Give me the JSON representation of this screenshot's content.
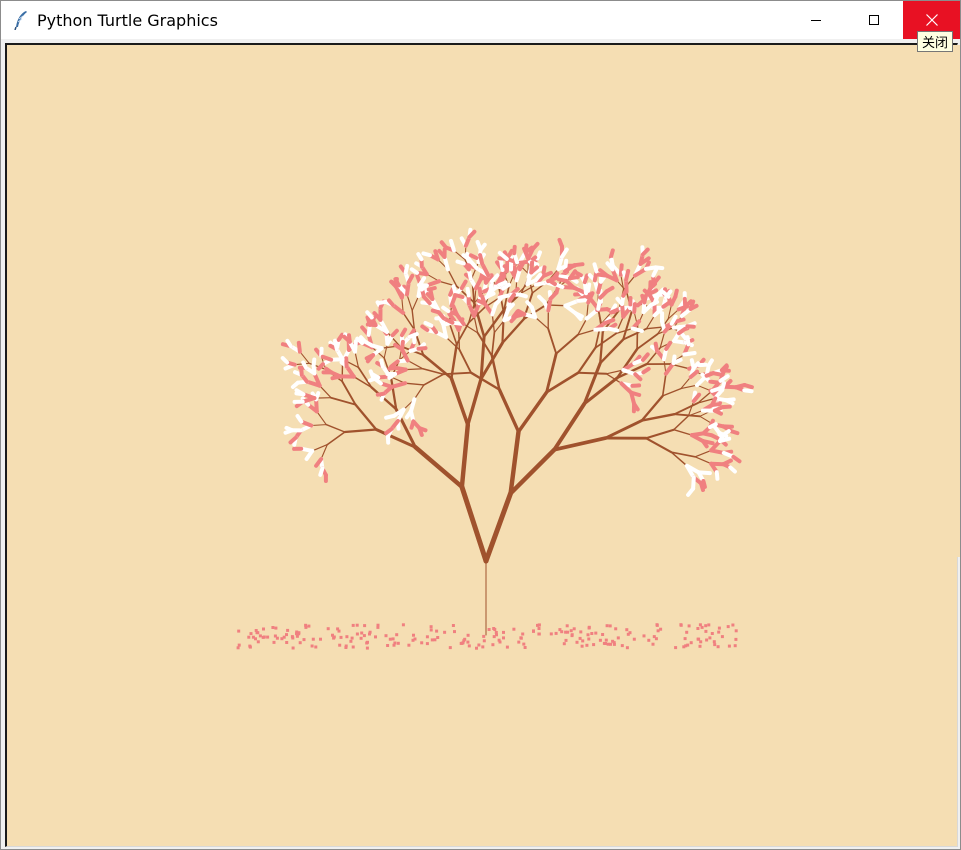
{
  "window": {
    "title": "Python Turtle Graphics",
    "icon": "feather-icon",
    "controls": {
      "minimize_icon": "minimize-icon",
      "maximize_icon": "maximize-icon",
      "close_icon": "close-icon"
    },
    "close_tooltip": "关闭"
  },
  "colors": {
    "canvas_background": "#f5deb3",
    "branch": "#a0522d",
    "blossom_pink": "#f08080",
    "blossom_white": "#ffffff",
    "close_button": "#e81123"
  },
  "canvas": {
    "scene": "fractal-tree-with-blossoms"
  }
}
